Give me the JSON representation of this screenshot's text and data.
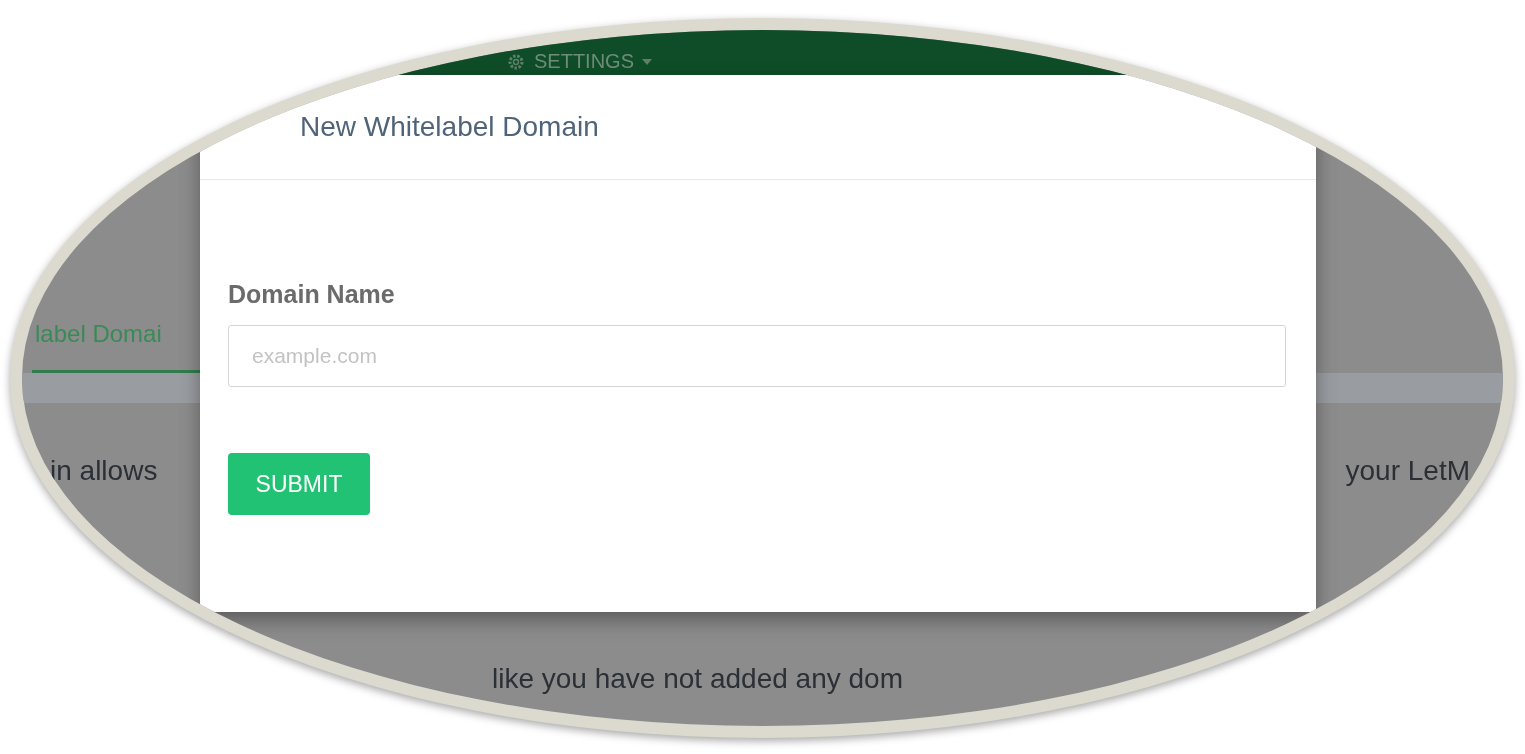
{
  "nav": {
    "settings": "SETTINGS"
  },
  "tabs": [
    {
      "label": "label Domai",
      "selected": true
    }
  ],
  "description": {
    "left": "in allows",
    "right": "your LetM"
  },
  "modal": {
    "title": "New Whitelabel Domain",
    "field": {
      "label": "Domain Name",
      "placeholder": "example.com"
    },
    "submit": "SUBMIT"
  },
  "empty_message": "like you have not added any dom"
}
